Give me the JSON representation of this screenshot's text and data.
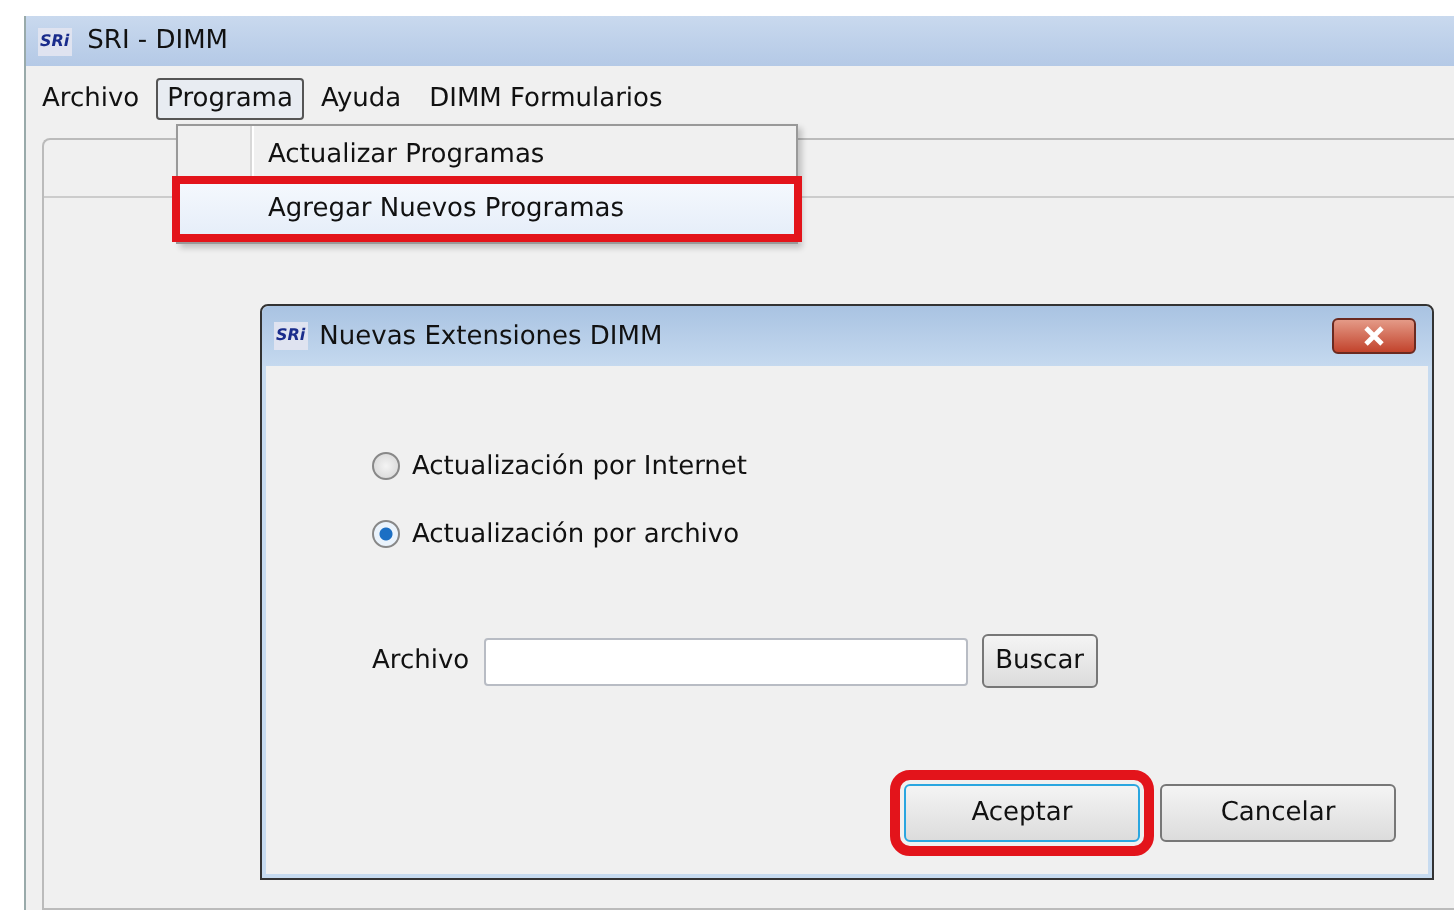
{
  "window": {
    "title": "SRI - DIMM",
    "logo": "SRi"
  },
  "menu_bar": [
    {
      "label": "Archivo",
      "selected": false
    },
    {
      "label": "Programa",
      "selected": true
    },
    {
      "label": "Ayuda",
      "selected": false
    },
    {
      "label": "DIMM Formularios",
      "selected": false
    }
  ],
  "dropdown": {
    "items": [
      {
        "label": "Actualizar Programas",
        "highlighted": false
      },
      {
        "label": "Agregar Nuevos Programas",
        "highlighted": true
      }
    ]
  },
  "dialog": {
    "title": "Nuevas Extensiones DIMM",
    "logo": "SRi",
    "options": [
      {
        "label": "Actualización por Internet",
        "selected": false
      },
      {
        "label": "Actualización por archivo",
        "selected": true
      }
    ],
    "file_label": "Archivo",
    "browse_button": "Buscar",
    "buttons": [
      {
        "label": "Aceptar",
        "highlighted": true
      },
      {
        "label": "Cancelar",
        "highlighted": false
      }
    ]
  }
}
